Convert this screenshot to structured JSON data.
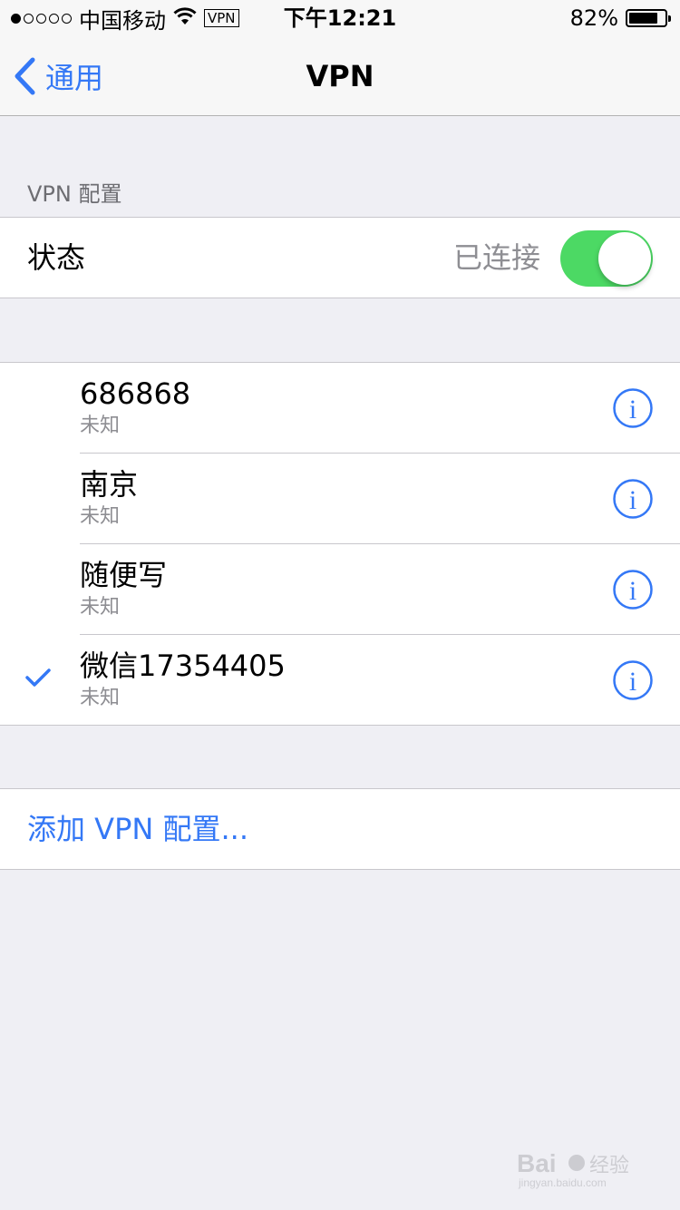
{
  "status_bar": {
    "carrier": "中国移动",
    "vpn_badge": "VPN",
    "time": "下午12:21",
    "battery_percent": "82%",
    "battery_level": 0.82,
    "signal_bars_filled": 1,
    "signal_bars_total": 5,
    "icons": [
      "signal-icon",
      "wifi-icon",
      "battery-icon"
    ]
  },
  "nav": {
    "back_label": "通用",
    "title": "VPN"
  },
  "section": {
    "header": "VPN 配置"
  },
  "status_row": {
    "label": "状态",
    "value": "已连接",
    "toggle_on": true
  },
  "vpn_items": [
    {
      "name": "686868",
      "status": "未知",
      "selected": false
    },
    {
      "name": "南京",
      "status": "未知",
      "selected": false
    },
    {
      "name": "随便写",
      "status": "未知",
      "selected": false
    },
    {
      "name": "微信17354405",
      "status": "未知",
      "selected": true
    }
  ],
  "add_row": {
    "label": "添加 VPN 配置..."
  },
  "watermark": {
    "brand": "Bai du 经验",
    "url": "jingyan.baidu.com"
  },
  "colors": {
    "accent": "#3478f6",
    "toggle_on": "#4cd964",
    "background": "#efeff4",
    "secondary_text": "#8e8e93"
  }
}
